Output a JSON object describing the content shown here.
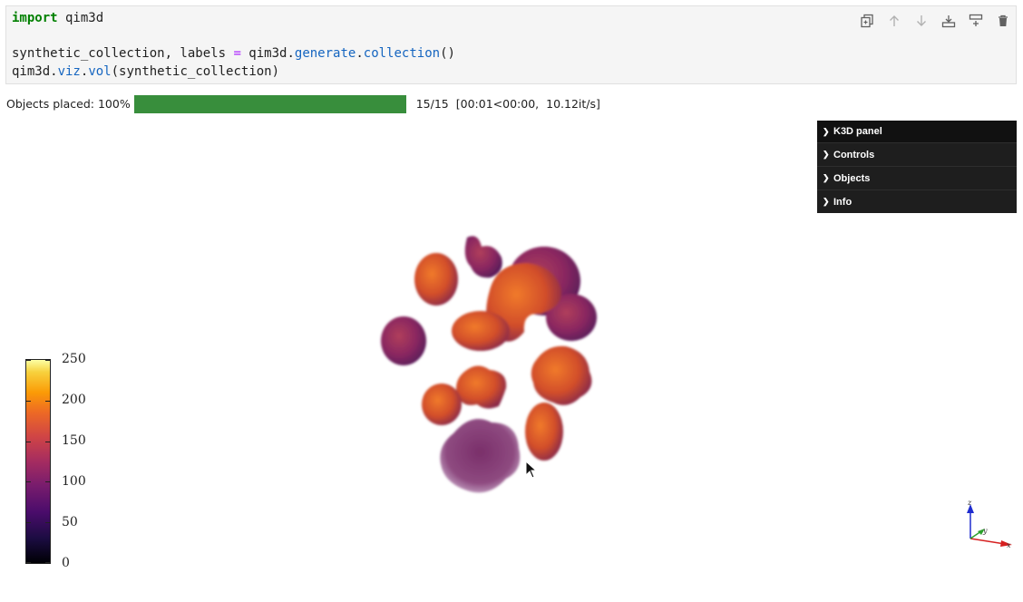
{
  "code_cell": {
    "line1": {
      "kw": "import",
      "rest": " qim3d"
    },
    "line2": {
      "a": "synthetic_collection, labels ",
      "eq": "=",
      "b": " qim3d.",
      "c": "generate",
      "d": ".",
      "e": "collection",
      "f": "()"
    },
    "line3": {
      "a": "qim3d.",
      "b": "viz",
      "c": ".",
      "d": "vol",
      "e": "(synthetic_collection)"
    }
  },
  "toolbar": {
    "icons": [
      "copy-icon",
      "move-up-icon",
      "move-down-icon",
      "insert-below-icon",
      "insert-above-icon",
      "delete-icon"
    ]
  },
  "progress": {
    "label": "Objects  placed:",
    "percent_text": "100%",
    "fraction": 1.0,
    "count": "15/15",
    "timing": "[00:01<00:00,",
    "rate": "10.12it/s]",
    "bar_color": "#388e3c"
  },
  "k3d_panel": {
    "title": "K3D panel",
    "sections": [
      "Controls",
      "Objects",
      "Info"
    ]
  },
  "colorbar": {
    "colormap": "inferno",
    "ticks": [
      "250",
      "200",
      "150",
      "100",
      "50",
      "0"
    ],
    "range": [
      0,
      250
    ]
  },
  "axes_widget": {
    "x": "x",
    "y": "y",
    "z": "z"
  }
}
